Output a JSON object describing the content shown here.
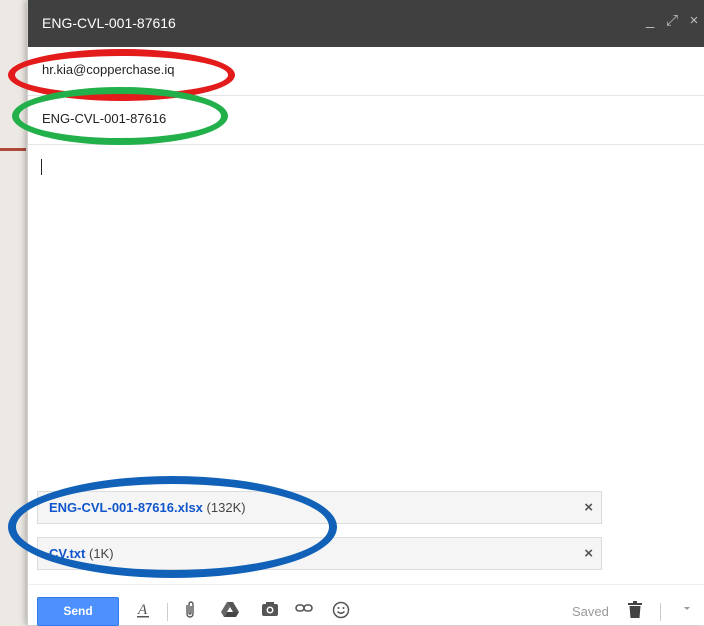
{
  "window": {
    "title": "ENG-CVL-001-87616",
    "controls": [
      "_",
      "⤢",
      "×"
    ]
  },
  "to_field": {
    "value": "hr.kia@copperchase.iq"
  },
  "subject_field": {
    "value": "ENG-CVL-001-87616"
  },
  "attachments": [
    {
      "name": "ENG-CVL-001-87616.xlsx",
      "size": "(132K)",
      "remove": "×"
    },
    {
      "name": "CV.txt",
      "size": "(1K)",
      "remove": "×"
    }
  ],
  "toolbar": {
    "send_label": "Send",
    "saved_label": "Saved",
    "icons": [
      "format-text-icon",
      "attach-file-icon",
      "drive-icon",
      "insert-photo-icon",
      "insert-link-icon",
      "emoji-icon",
      "trash-icon",
      "more-options-icon"
    ]
  },
  "annotation_colors": {
    "red": "#e31b1b",
    "green": "#22b04a",
    "blue": "#1161b8"
  }
}
